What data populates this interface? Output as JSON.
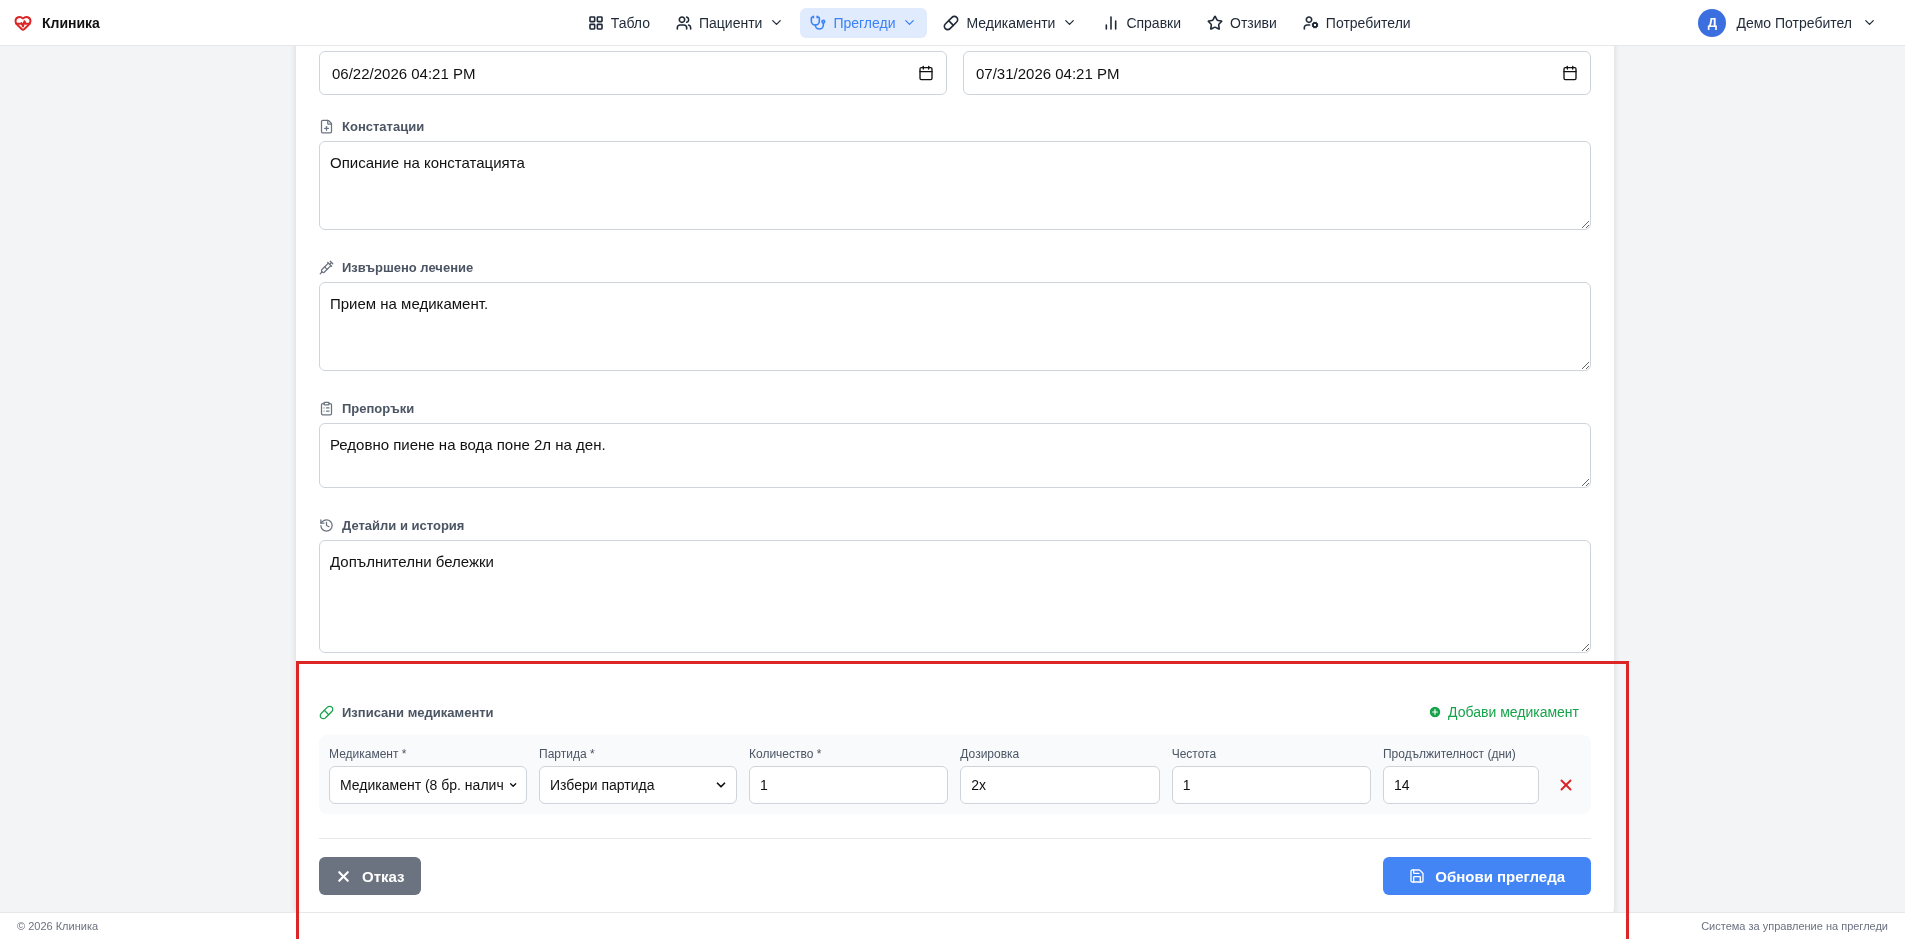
{
  "brand": "Клиника",
  "nav": [
    {
      "label": "Табло",
      "dropdown": false,
      "selected": false
    },
    {
      "label": "Пациенти",
      "dropdown": true,
      "selected": false
    },
    {
      "label": "Прегледи",
      "dropdown": true,
      "selected": true
    },
    {
      "label": "Медикаменти",
      "dropdown": true,
      "selected": false
    },
    {
      "label": "Справки",
      "dropdown": false,
      "selected": false
    },
    {
      "label": "Отзиви",
      "dropdown": false,
      "selected": false
    },
    {
      "label": "Потребители",
      "dropdown": false,
      "selected": false
    }
  ],
  "user": {
    "initial": "Д",
    "name": "Демо Потребител"
  },
  "dates": [
    {
      "value": "06/22/2026 04:21 PM"
    },
    {
      "value": "07/31/2026 04:21 PM"
    }
  ],
  "text_fields": [
    {
      "label": "Констатации",
      "value": "Описание на констатацията"
    },
    {
      "label": "Извършено лечение",
      "value": "Прием на медикамент."
    },
    {
      "label": "Препоръки",
      "value": "Редовно пиене на вода поне 2л на ден."
    },
    {
      "label": "Детайли и история",
      "value": "Допълнителни бележки"
    }
  ],
  "medications": {
    "title": "Изписани медикаменти",
    "add_button": "Добави медикамент",
    "highlighted": true,
    "columns": [
      "Медикамент *",
      "Партида *",
      "Количество *",
      "Дозировка",
      "Честота",
      "Продължителност (дни)"
    ],
    "rows": [
      {
        "cells": [
          {
            "kind": "select",
            "value": "Медикамент (8 бр. налич"
          },
          {
            "kind": "select",
            "value": "Избери партида"
          },
          {
            "kind": "input",
            "value": "1"
          },
          {
            "kind": "input",
            "value": "2x"
          },
          {
            "kind": "input",
            "value": "1"
          },
          {
            "kind": "input",
            "value": "14"
          }
        ]
      }
    ]
  },
  "actions": {
    "cancel": "Отказ",
    "submit": "Обнови прегледа"
  },
  "footer": {
    "left": "© 2026 Клиника",
    "right": "Система за управление на прегледи"
  }
}
